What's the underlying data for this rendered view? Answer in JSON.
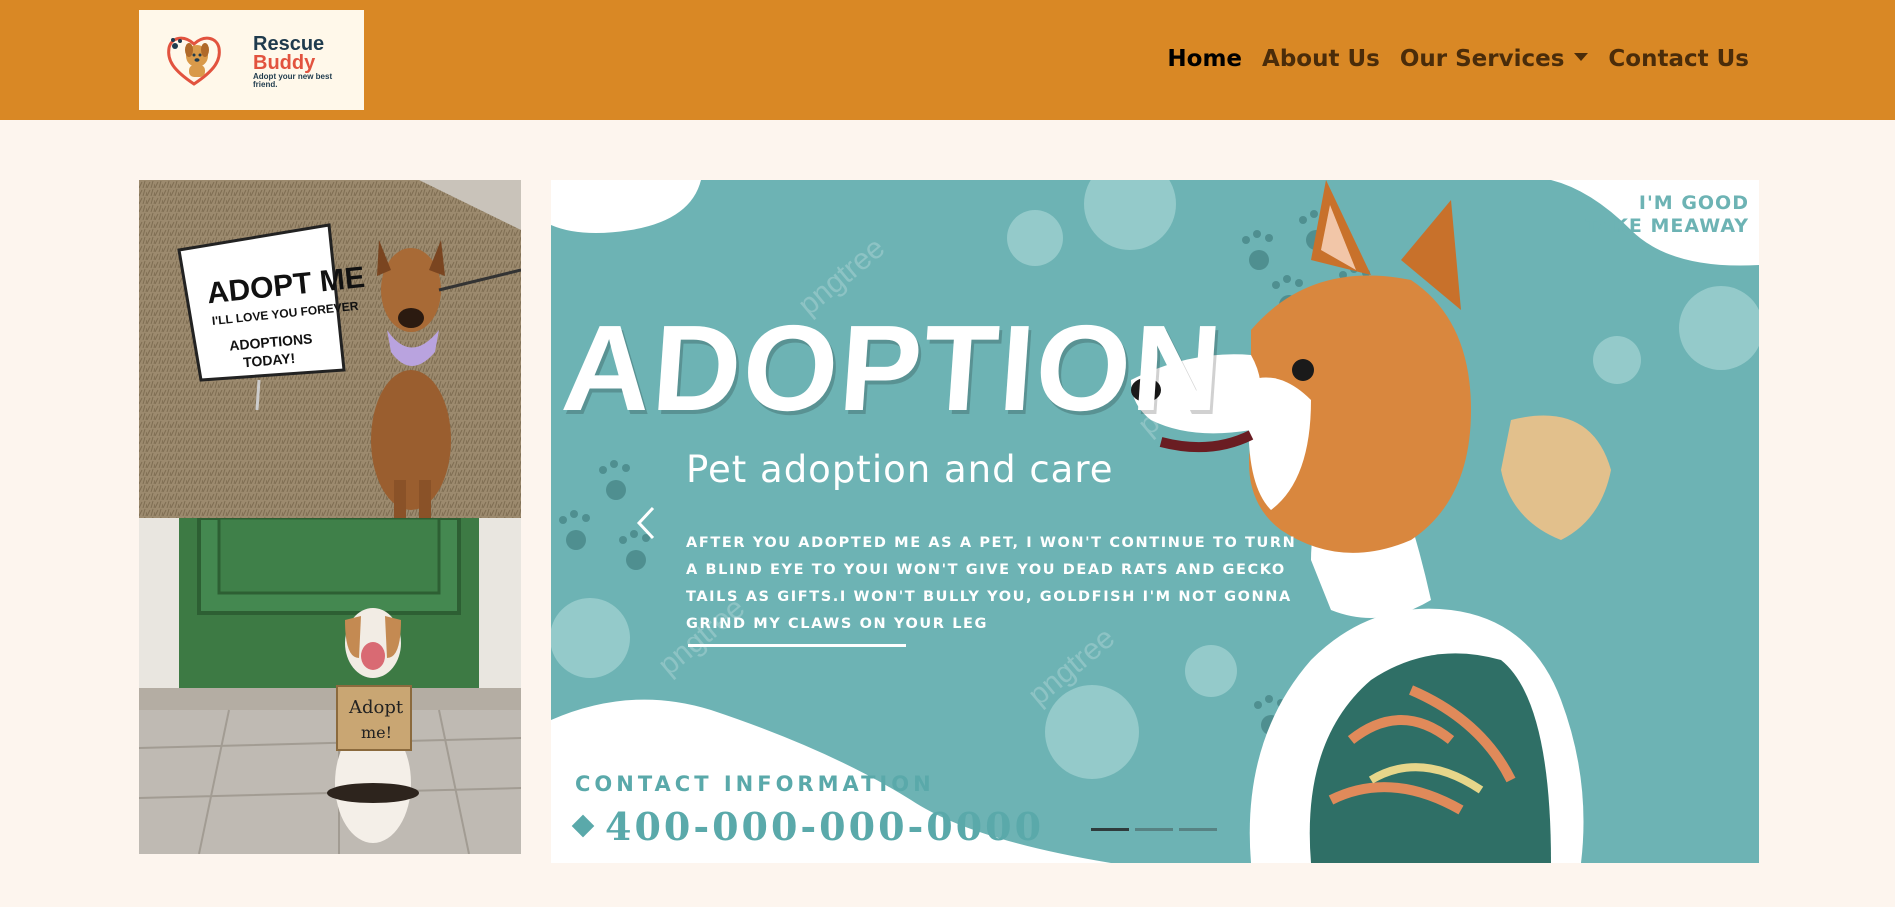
{
  "brand": {
    "name_line1": "Rescue",
    "name_line2": "Buddy",
    "tagline": "Adopt your new best friend."
  },
  "nav": {
    "items": [
      {
        "label": "Home",
        "active": true
      },
      {
        "label": "About Us",
        "active": false
      },
      {
        "label": "Our Services",
        "active": false,
        "dropdown": true
      },
      {
        "label": "Contact Us",
        "active": false
      }
    ]
  },
  "photos": {
    "photo1_sign": {
      "line1": "ADOPT ME",
      "line2": "I'LL LOVE YOU FOREVER",
      "line3": "ADOPTIONS",
      "line4": "TODAY!"
    },
    "photo2_sign": {
      "line1": "Adopt",
      "line2": "me!"
    }
  },
  "carousel": {
    "corner_text_line1": "I'M GOOD",
    "corner_text_line2": "TAKE MEAWAY",
    "headline": "ADOPTION",
    "subtitle": "Pet adoption and care",
    "paragraph": "AFTER YOU ADOPTED ME AS A PET, I WON'T CONTINUE TO TURN A BLIND EYE TO YOUI WON'T GIVE YOU DEAD RATS AND GECKO TAILS AS GIFTS.I WON'T BULLY YOU, GOLDFISH I'M NOT GONNA GRIND MY CLAWS ON YOUR LEG",
    "contact_label": "CONTACT INFORMATION",
    "phone": "400-000-000-0000",
    "watermark": "pngtree",
    "slide_count": 3,
    "active_slide": 1
  },
  "colors": {
    "navbar": "#d98825",
    "page_bg": "#fdf5ee",
    "teal": "#6db3b4",
    "logo_red": "#e2533f",
    "logo_navy": "#1f3b4d"
  },
  "icons": {
    "prev": "chevron-left-icon",
    "dropdown": "caret-down-icon",
    "paw": "paw-print-icon",
    "logo": "dog-heart-logo-icon"
  }
}
